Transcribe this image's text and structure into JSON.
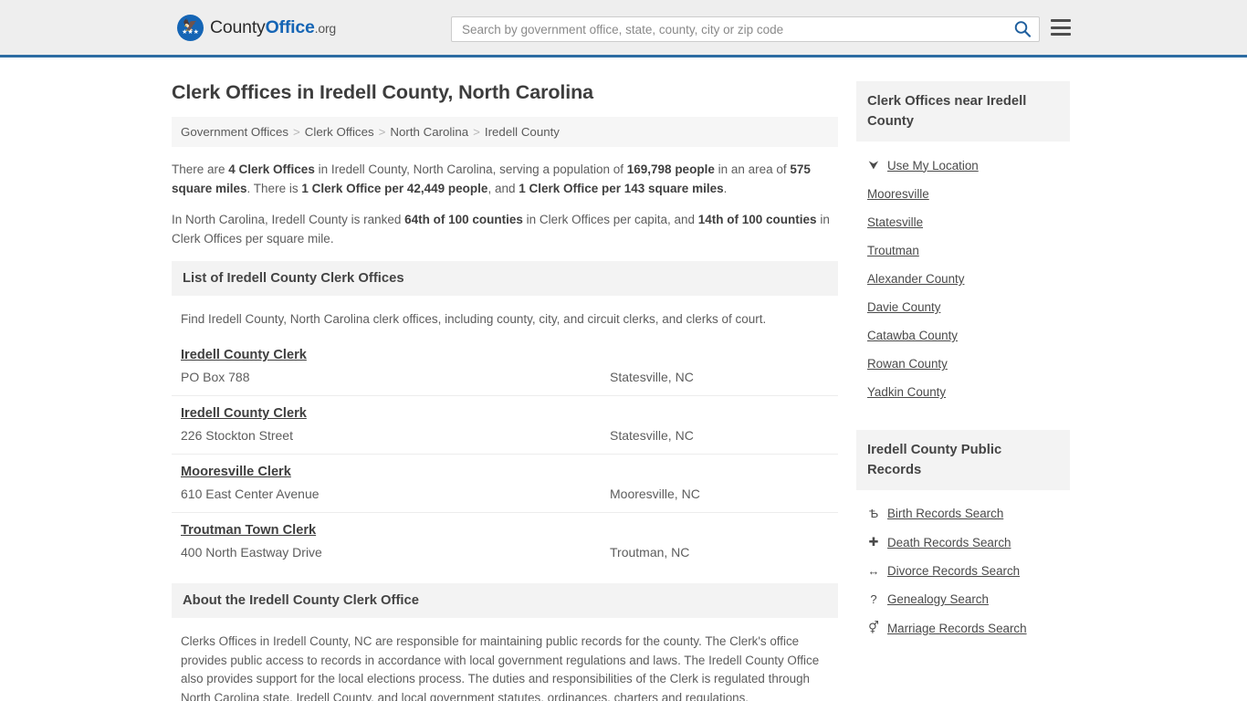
{
  "header": {
    "logo_name_part1": "County",
    "logo_name_part2": "Office",
    "logo_name_part3": ".org",
    "logo_icon": "eagle-shield-icon",
    "search_placeholder": "Search by government office, state, county, city or zip code",
    "search_value": "",
    "search_icon": "search-icon",
    "menu_icon": "hamburger-menu-icon",
    "accent_color": "#2d6ca2",
    "background_color": "#eeeeee"
  },
  "page": {
    "title": "Clerk Offices in Iredell County, North Carolina"
  },
  "breadcrumb": {
    "separator": ">",
    "items": [
      {
        "label": "Government Offices"
      },
      {
        "label": "Clerk Offices"
      },
      {
        "label": "North Carolina"
      },
      {
        "label": "Iredell County"
      }
    ]
  },
  "intro": {
    "p1_parts": [
      {
        "t": "There are ",
        "b": false
      },
      {
        "t": "4 Clerk Offices",
        "b": true
      },
      {
        "t": " in Iredell County, North Carolina, serving a population of ",
        "b": false
      },
      {
        "t": "169,798 people",
        "b": true
      },
      {
        "t": " in an area of ",
        "b": false
      },
      {
        "t": "575 square miles",
        "b": true
      },
      {
        "t": ". There is ",
        "b": false
      },
      {
        "t": "1 Clerk Office per 42,449 people",
        "b": true
      },
      {
        "t": ", and ",
        "b": false
      },
      {
        "t": "1 Clerk Office per 143 square miles",
        "b": true
      },
      {
        "t": ".",
        "b": false
      }
    ],
    "p2_parts": [
      {
        "t": "In North Carolina, Iredell County is ranked ",
        "b": false
      },
      {
        "t": "64th of 100 counties",
        "b": true
      },
      {
        "t": " in Clerk Offices per capita, and ",
        "b": false
      },
      {
        "t": "14th of 100 counties",
        "b": true
      },
      {
        "t": " in Clerk Offices per square mile.",
        "b": false
      }
    ]
  },
  "list_section": {
    "heading": "List of Iredell County Clerk Offices",
    "description": "Find Iredell County, North Carolina clerk offices, including county, city, and circuit clerks, and clerks of court.",
    "offices": [
      {
        "name": "Iredell County Clerk",
        "address": "PO Box 788",
        "city": "Statesville, NC"
      },
      {
        "name": "Iredell County Clerk",
        "address": "226 Stockton Street",
        "city": "Statesville, NC"
      },
      {
        "name": "Mooresville Clerk",
        "address": "610 East Center Avenue",
        "city": "Mooresville, NC"
      },
      {
        "name": "Troutman Town Clerk",
        "address": "400 North Eastway Drive",
        "city": "Troutman, NC"
      }
    ]
  },
  "about_section": {
    "heading": "About the Iredell County Clerk Office",
    "body": "Clerks Offices in Iredell County, NC are responsible for maintaining public records for the county. The Clerk's office provides public access to records in accordance with local government regulations and laws. The Iredell County Office also provides support for the local elections process. The duties and responsibilities of the Clerk is regulated through North Carolina state, Iredell County, and local government statutes, ordinances, charters and regulations."
  },
  "sidebar": {
    "nearby": {
      "heading": "Clerk Offices near Iredell County",
      "items": [
        {
          "label": "Use My Location",
          "icon": "map-pin-icon",
          "glyph": "⮟"
        },
        {
          "label": "Mooresville",
          "icon": "",
          "glyph": ""
        },
        {
          "label": "Statesville",
          "icon": "",
          "glyph": ""
        },
        {
          "label": "Troutman",
          "icon": "",
          "glyph": ""
        },
        {
          "label": "Alexander County",
          "icon": "",
          "glyph": ""
        },
        {
          "label": "Davie County",
          "icon": "",
          "glyph": ""
        },
        {
          "label": "Catawba County",
          "icon": "",
          "glyph": ""
        },
        {
          "label": "Rowan County",
          "icon": "",
          "glyph": ""
        },
        {
          "label": "Yadkin County",
          "icon": "",
          "glyph": ""
        }
      ]
    },
    "public_records": {
      "heading": "Iredell County Public Records",
      "items": [
        {
          "label": "Birth Records Search",
          "icon": "baby-icon",
          "glyph": "Ѣ"
        },
        {
          "label": "Death Records Search",
          "icon": "cross-icon",
          "glyph": "✚"
        },
        {
          "label": "Divorce Records Search",
          "icon": "left-right-arrow-icon",
          "glyph": "↔"
        },
        {
          "label": "Genealogy Search",
          "icon": "question-mark-icon",
          "glyph": "?"
        },
        {
          "label": "Marriage Records Search",
          "icon": "male-female-icon",
          "glyph": "⚥"
        }
      ]
    }
  }
}
